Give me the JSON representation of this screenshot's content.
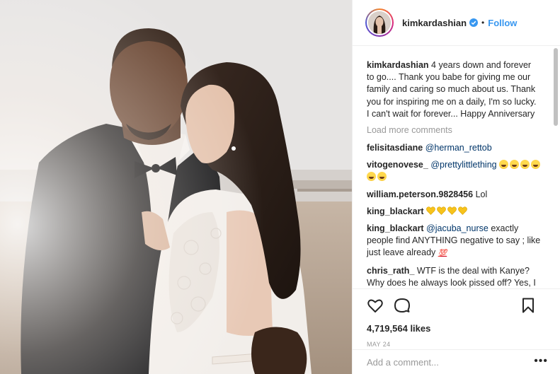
{
  "post": {
    "username": "kimkardashian",
    "follow_label": "Follow",
    "separator": "•",
    "verified_icon": "verified-badge-icon",
    "caption_user": "kimkardashian",
    "caption_text": "4 years down and forever to go.... Thank you babe for giving me our family and caring so much about us. Thank you for inspiring me on a daily, I'm so lucky. I can't wait for forever... Happy Anniversary",
    "load_more": "Load more comments",
    "likes": "4,719,564 likes",
    "date": "MAY 24",
    "add_comment_placeholder": "Add a comment...",
    "more_options": "•••"
  },
  "comments": [
    {
      "user": "felisitasdiane",
      "mention": "@herman_rettob",
      "text": ""
    },
    {
      "user": "vitogenovese_",
      "mention": "@prettylittlething",
      "text": "",
      "emoji": "face-with-tears-of-joy x6"
    },
    {
      "user": "william.peterson.9828456",
      "mention": "",
      "text": "Lol"
    },
    {
      "user": "king_blackart",
      "mention": "",
      "text": "",
      "emoji": "yellow-heart x4"
    },
    {
      "user": "king_blackart",
      "mention": "@jacuba_nurse",
      "text": "exactly people find ANYTHING negative to say ; like just leave already",
      "emoji": "hundred-points"
    },
    {
      "user": "chris_rath_",
      "mention": "",
      "text": "WTF is the deal with Kanye? Why does he always look pissed off? Yes, I get it, so he married a Kardashian. I"
    }
  ],
  "colors": {
    "link_blue": "#3897f0",
    "mention_blue": "#003569",
    "text": "#262626",
    "muted": "#999999",
    "border": "#efefef"
  }
}
